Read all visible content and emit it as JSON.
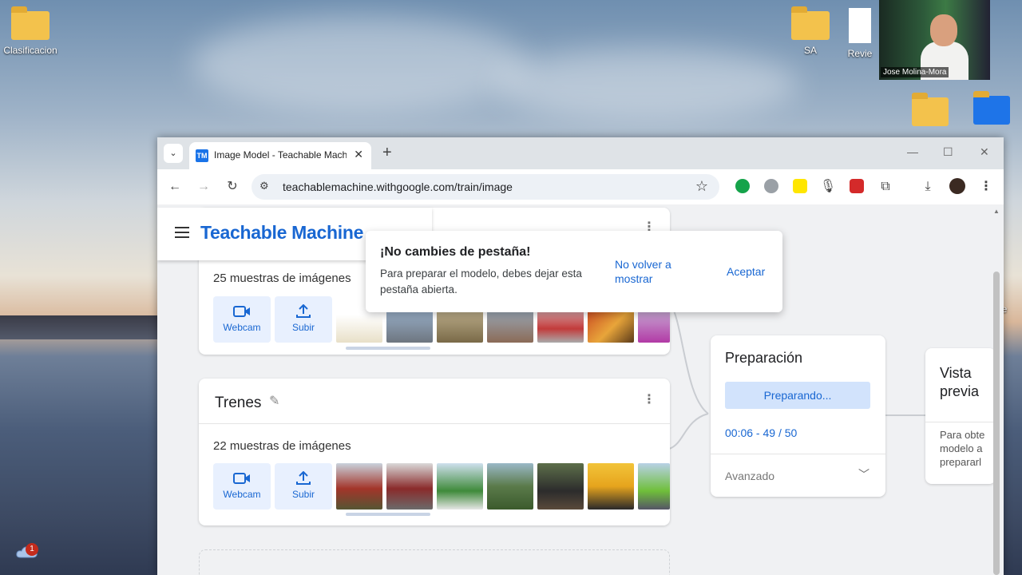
{
  "desktop": {
    "icons": [
      {
        "label": "Clasificacion"
      },
      {
        "label": "SA"
      },
      {
        "label": "Revie"
      },
      {
        "label": "de"
      }
    ],
    "webcam_name": "Jose Molina-Mora",
    "notification_count": "1"
  },
  "browser": {
    "tab_title": "Image Model - Teachable Machine",
    "tab_favicon": "TM",
    "url": "teachablemachine.withgoogle.com/train/image"
  },
  "app": {
    "brand": "Teachable Machine"
  },
  "classes": [
    {
      "name": "",
      "samples": "25 muestras de imágenes",
      "webcam_label": "Webcam",
      "upload_label": "Subir"
    },
    {
      "name": "Trenes",
      "samples": "22 muestras de imágenes",
      "webcam_label": "Webcam",
      "upload_label": "Subir"
    }
  ],
  "training": {
    "title": "Preparación",
    "button": "Preparando...",
    "progress": "00:06 - 49 / 50",
    "advanced": "Avanzado"
  },
  "preview": {
    "title": "Vista previa",
    "body": "Para obte modelo a prepararl"
  },
  "dialog": {
    "title": "¡No cambies de pestaña!",
    "body": "Para preparar el modelo, debes dejar esta pestaña abierta.",
    "secondary": "No volver a mostrar",
    "primary": "Aceptar"
  },
  "colors": {
    "accent": "#1967d2",
    "tile_bg": "#e8f0fe",
    "train_btn_bg": "#d2e3fc"
  }
}
